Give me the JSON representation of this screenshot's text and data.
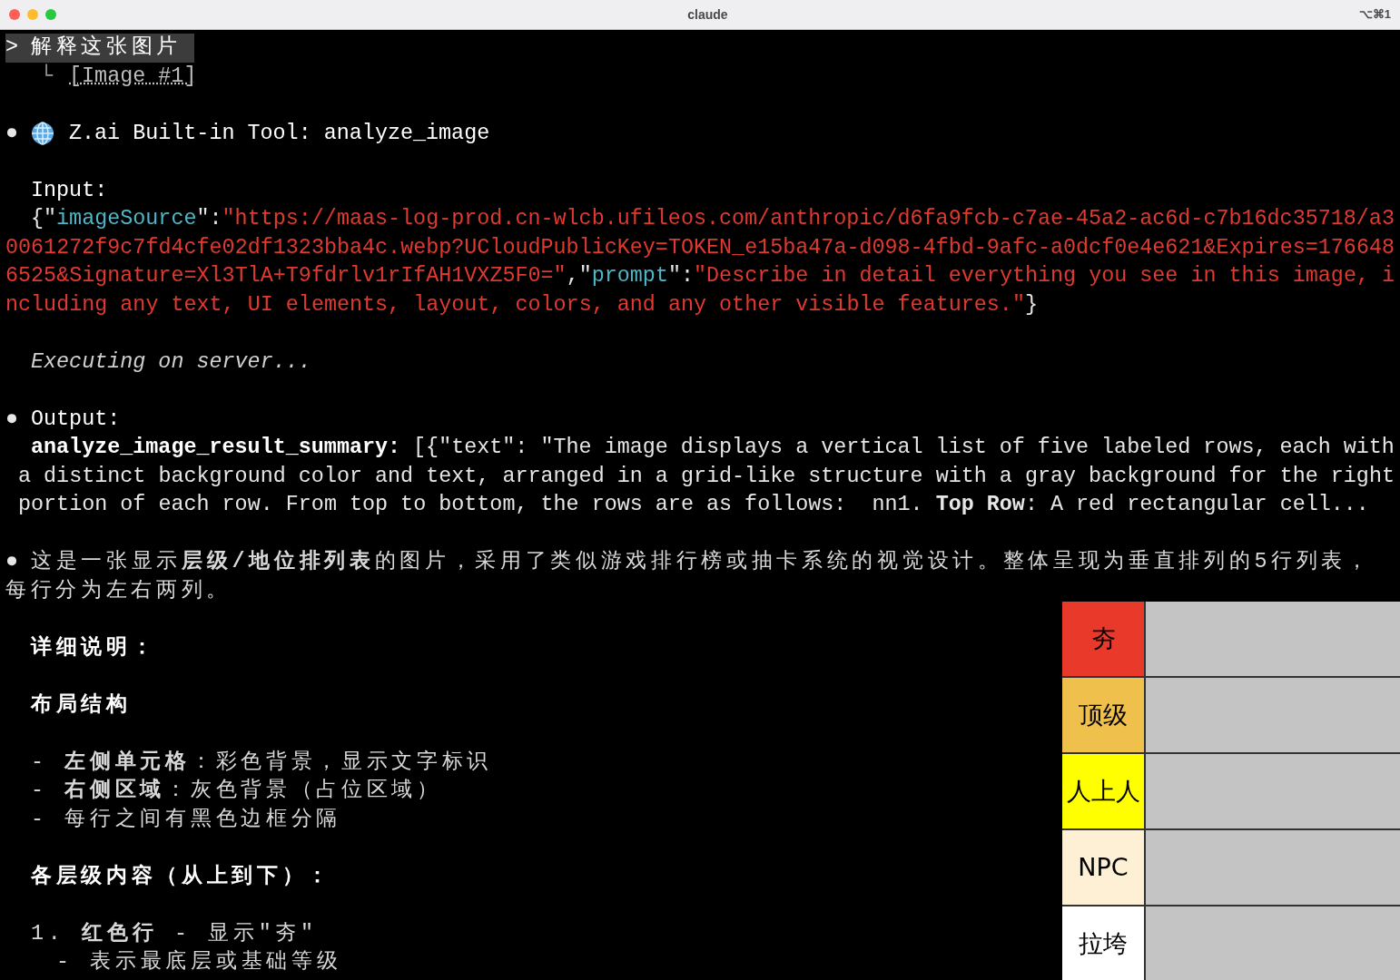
{
  "window": {
    "title": "claude",
    "shortcut": "⌥⌘1"
  },
  "prompt": {
    "marker": ">",
    "text": "解释这张图片"
  },
  "attachment": {
    "branch": "└",
    "label": "[Image #1]"
  },
  "tool_call": {
    "bullet": "●",
    "title": "Z.ai Built-in Tool: analyze_image",
    "input_label": "Input:",
    "input_lines": [
      [
        {
          "kind": "punct",
          "text": "{\""
        },
        {
          "kind": "key",
          "text": "imageSource"
        },
        {
          "kind": "punct",
          "text": "\":"
        },
        {
          "kind": "string",
          "text": "\"https://maas-log-prod.cn-wlcb.ufileos.com/anthropic/d6fa9fcb-c7ae-45a2-ac6d-c7b16dc35718/a3"
        }
      ],
      [
        {
          "kind": "string",
          "text": "0061272f9c7fd4cfe02df1323bba4c.webp?UCloudPublicKey=TOKEN_e15ba47a-d098-4fbd-9afc-a0dcf0e4e621&Expires=176648"
        }
      ],
      [
        {
          "kind": "string",
          "text": "6525&Signature=Xl3TlA+T9fdrlv1rIfAH1VXZ5F0=\""
        },
        {
          "kind": "punct",
          "text": ",\""
        },
        {
          "kind": "key",
          "text": "prompt"
        },
        {
          "kind": "punct",
          "text": "\":"
        },
        {
          "kind": "string",
          "text": "\"Describe in detail everything you see in this image, i"
        }
      ],
      [
        {
          "kind": "string",
          "text": "ncluding any text, UI elements, layout, colors, and any other visible features.\""
        },
        {
          "kind": "punct",
          "text": "}"
        }
      ]
    ],
    "status": "Executing on server..."
  },
  "output": {
    "bullet": "●",
    "label": "Output:",
    "summary_label": "analyze_image_result_summary:",
    "summary_lines": [
      "[{\"text\": \"The image displays a vertical list of five labeled rows, each with",
      "a distinct background color and text, arranged in a grid-like structure with a gray background for the right",
      "portion of each row. From top to bottom, the rows are as follows:  nn1. **Top Row**: A red rectangular cell..."
    ]
  },
  "answer": {
    "bullet": "●",
    "intro_lines": [
      "这是一张显示**层级/地位排列表**的图片，采用了类似游戏排行榜或抽卡系统的视觉设计。整体呈现为垂直排列的5行列表，",
      "每行分为左右两列。"
    ],
    "blocks": [
      [
        {
          "kind": "heading",
          "text": "详细说明："
        }
      ],
      [
        {
          "kind": "heading",
          "text": "布局结构"
        }
      ],
      [
        {
          "kind": "dash",
          "text": "- **左侧单元格**：彩色背景，显示文字标识"
        },
        {
          "kind": "dash",
          "text": "- **右侧区域**：灰色背景（占位区域）"
        },
        {
          "kind": "dash",
          "text": "- 每行之间有黑色边框分隔"
        }
      ],
      [
        {
          "kind": "heading",
          "text": "各层级内容（从上到下）："
        }
      ],
      [
        {
          "kind": "numbered",
          "text": "1. **红色行** - 显示\"夯\""
        },
        {
          "kind": "sub",
          "text": "- 表示最底层或基础等级"
        }
      ]
    ]
  },
  "tier_list": {
    "rows": [
      {
        "label": "夯",
        "color": "#e8392a"
      },
      {
        "label": "顶级",
        "color": "#f0c04c"
      },
      {
        "label": "人上人",
        "color": "#ffff00"
      },
      {
        "label": "NPC",
        "color": "#fdf0d5"
      },
      {
        "label": "拉垮",
        "color": "#ffffff"
      }
    ]
  }
}
